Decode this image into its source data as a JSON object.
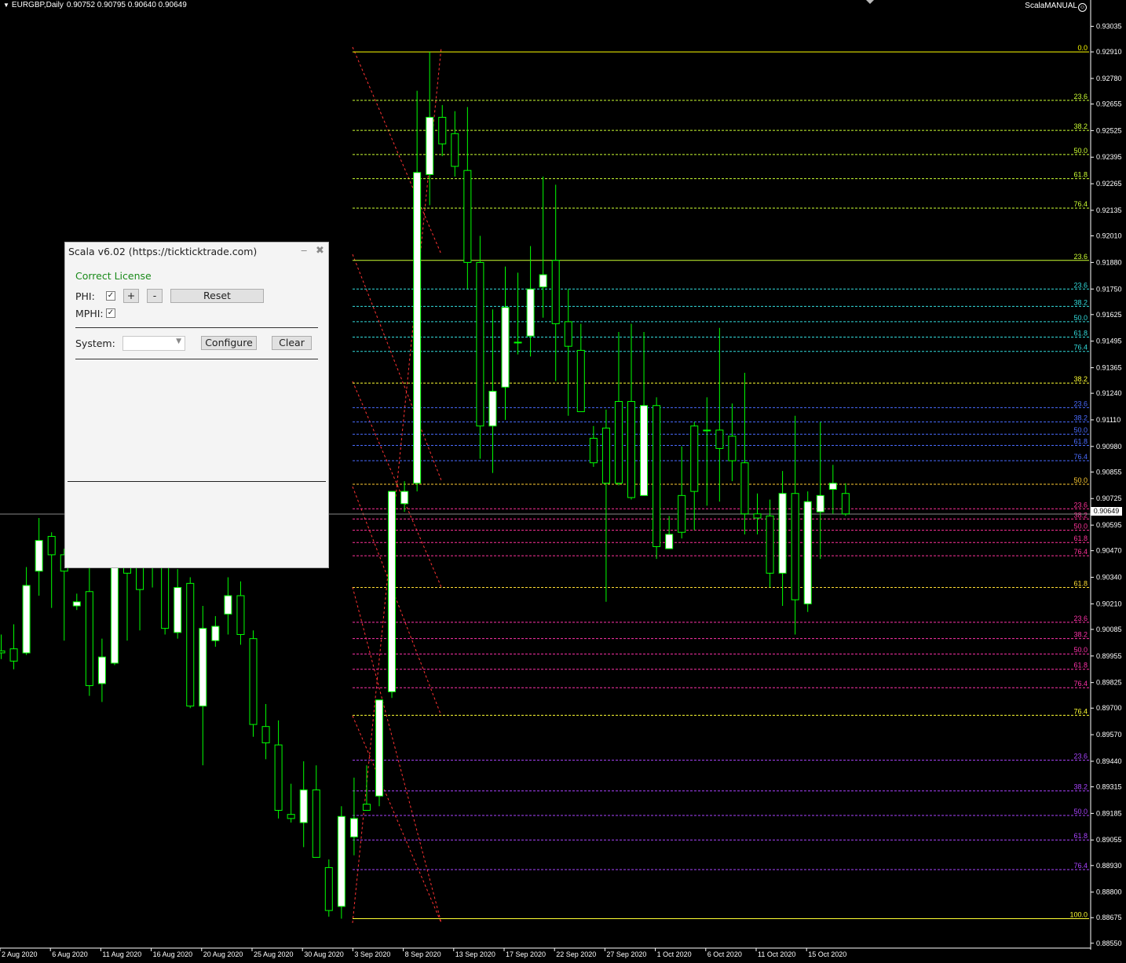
{
  "chart_header": {
    "symbol": "EURGBP,Daily",
    "ohlc": "0.90752 0.90795 0.90640 0.90649",
    "brand": "ScalaMANUAL"
  },
  "current_price": "0.90649",
  "colors": {
    "background": "#000000",
    "bull_fill": "#ffffff",
    "bear_fill": "#000000",
    "candle_border": "#00ff00",
    "axis_text": "#ffffff"
  },
  "chart_data": {
    "type": "candlestick",
    "price_axis": {
      "min": 0.8853,
      "max": 0.9311,
      "ticks": [
        "0.93035",
        "0.92910",
        "0.92780",
        "0.92655",
        "0.92525",
        "0.92395",
        "0.92265",
        "0.92135",
        "0.92010",
        "0.91880",
        "0.91750",
        "0.91625",
        "0.91495",
        "0.91365",
        "0.91240",
        "0.91110",
        "0.90980",
        "0.90855",
        "0.90725",
        "0.90595",
        "0.90470",
        "0.90340",
        "0.90210",
        "0.90085",
        "0.89955",
        "0.89825",
        "0.89700",
        "0.89570",
        "0.89440",
        "0.89315",
        "0.89185",
        "0.89055",
        "0.88930",
        "0.88800",
        "0.88675",
        "0.88550"
      ]
    },
    "date_labels": [
      "2 Aug 2020",
      "6 Aug 2020",
      "11 Aug 2020",
      "16 Aug 2020",
      "20 Aug 2020",
      "25 Aug 2020",
      "30 Aug 2020",
      "3 Sep 2020",
      "8 Sep 2020",
      "13 Sep 2020",
      "17 Sep 2020",
      "22 Sep 2020",
      "27 Sep 2020",
      "1 Oct 2020",
      "6 Oct 2020",
      "11 Oct 2020",
      "15 Oct 2020"
    ],
    "candles": [
      {
        "o": 0.8998,
        "h": 0.9006,
        "l": 0.8994,
        "c": 0.8997
      },
      {
        "o": 0.8999,
        "h": 0.9011,
        "l": 0.8989,
        "c": 0.8993
      },
      {
        "o": 0.8997,
        "h": 0.9039,
        "l": 0.8996,
        "c": 0.903
      },
      {
        "o": 0.9037,
        "h": 0.9063,
        "l": 0.9025,
        "c": 0.9052
      },
      {
        "o": 0.9054,
        "h": 0.9056,
        "l": 0.9019,
        "c": 0.9045
      },
      {
        "o": 0.9045,
        "h": 0.9048,
        "l": 0.9003,
        "c": 0.9037
      },
      {
        "o": 0.902,
        "h": 0.9026,
        "l": 0.9018,
        "c": 0.9022
      },
      {
        "o": 0.9027,
        "h": 0.9049,
        "l": 0.8976,
        "c": 0.8981
      },
      {
        "o": 0.8982,
        "h": 0.9004,
        "l": 0.8973,
        "c": 0.8995
      },
      {
        "o": 0.8992,
        "h": 0.9052,
        "l": 0.8991,
        "c": 0.9043
      },
      {
        "o": 0.9044,
        "h": 0.9048,
        "l": 0.9003,
        "c": 0.9036
      },
      {
        "o": 0.905,
        "h": 0.9056,
        "l": 0.9008,
        "c": 0.9028
      },
      {
        "o": 0.904,
        "h": 0.9047,
        "l": 0.9029,
        "c": 0.9045
      },
      {
        "o": 0.9041,
        "h": 0.9045,
        "l": 0.9006,
        "c": 0.9009
      },
      {
        "o": 0.9007,
        "h": 0.9038,
        "l": 0.9004,
        "c": 0.9029
      },
      {
        "o": 0.9031,
        "h": 0.9034,
        "l": 0.897,
        "c": 0.8971
      },
      {
        "o": 0.8971,
        "h": 0.902,
        "l": 0.8942,
        "c": 0.9009
      },
      {
        "o": 0.9003,
        "h": 0.9015,
        "l": 0.9,
        "c": 0.901
      },
      {
        "o": 0.9016,
        "h": 0.9034,
        "l": 0.9006,
        "c": 0.9025
      },
      {
        "o": 0.9025,
        "h": 0.9032,
        "l": 0.9001,
        "c": 0.9006
      },
      {
        "o": 0.9004,
        "h": 0.9008,
        "l": 0.8956,
        "c": 0.8962
      },
      {
        "o": 0.8961,
        "h": 0.8972,
        "l": 0.8945,
        "c": 0.8953
      },
      {
        "o": 0.8952,
        "h": 0.8964,
        "l": 0.8916,
        "c": 0.892
      },
      {
        "o": 0.8918,
        "h": 0.8933,
        "l": 0.8914,
        "c": 0.8916
      },
      {
        "o": 0.8914,
        "h": 0.8944,
        "l": 0.8902,
        "c": 0.893
      },
      {
        "o": 0.893,
        "h": 0.8942,
        "l": 0.8899,
        "c": 0.8897
      },
      {
        "o": 0.8892,
        "h": 0.8896,
        "l": 0.8868,
        "c": 0.8871
      },
      {
        "o": 0.8873,
        "h": 0.8922,
        "l": 0.8867,
        "c": 0.8917
      },
      {
        "o": 0.8907,
        "h": 0.8936,
        "l": 0.8898,
        "c": 0.8916
      },
      {
        "o": 0.8923,
        "h": 0.8942,
        "l": 0.892,
        "c": 0.892
      },
      {
        "o": 0.8927,
        "h": 0.8966,
        "l": 0.8922,
        "c": 0.8974
      },
      {
        "o": 0.8978,
        "h": 0.9072,
        "l": 0.8975,
        "c": 0.9076
      },
      {
        "o": 0.907,
        "h": 0.9081,
        "l": 0.9066,
        "c": 0.9076
      },
      {
        "o": 0.908,
        "h": 0.9272,
        "l": 0.9076,
        "c": 0.9232
      },
      {
        "o": 0.9231,
        "h": 0.9291,
        "l": 0.9216,
        "c": 0.9259
      },
      {
        "o": 0.9259,
        "h": 0.9265,
        "l": 0.924,
        "c": 0.9246
      },
      {
        "o": 0.9251,
        "h": 0.9262,
        "l": 0.923,
        "c": 0.9235
      },
      {
        "o": 0.9233,
        "h": 0.9264,
        "l": 0.9175,
        "c": 0.9188
      },
      {
        "o": 0.9188,
        "h": 0.9201,
        "l": 0.9092,
        "c": 0.9108
      },
      {
        "o": 0.9108,
        "h": 0.9165,
        "l": 0.9085,
        "c": 0.9125
      },
      {
        "o": 0.9127,
        "h": 0.9186,
        "l": 0.9111,
        "c": 0.9166
      },
      {
        "o": 0.9149,
        "h": 0.9183,
        "l": 0.9143,
        "c": 0.9149
      },
      {
        "o": 0.9152,
        "h": 0.9196,
        "l": 0.9142,
        "c": 0.9175
      },
      {
        "o": 0.9176,
        "h": 0.923,
        "l": 0.9161,
        "c": 0.9182
      },
      {
        "o": 0.9189,
        "h": 0.9226,
        "l": 0.913,
        "c": 0.9158
      },
      {
        "o": 0.9159,
        "h": 0.9175,
        "l": 0.9113,
        "c": 0.9147
      },
      {
        "o": 0.9145,
        "h": 0.9158,
        "l": 0.9118,
        "c": 0.9115
      },
      {
        "o": 0.9102,
        "h": 0.9108,
        "l": 0.9088,
        "c": 0.909
      },
      {
        "o": 0.9107,
        "h": 0.9116,
        "l": 0.9022,
        "c": 0.908
      },
      {
        "o": 0.912,
        "h": 0.9154,
        "l": 0.9079,
        "c": 0.908
      },
      {
        "o": 0.912,
        "h": 0.9158,
        "l": 0.9072,
        "c": 0.9073
      },
      {
        "o": 0.9074,
        "h": 0.9154,
        "l": 0.9074,
        "c": 0.9118
      },
      {
        "o": 0.9118,
        "h": 0.9122,
        "l": 0.9043,
        "c": 0.9049
      },
      {
        "o": 0.9048,
        "h": 0.9064,
        "l": 0.9048,
        "c": 0.9055
      },
      {
        "o": 0.9074,
        "h": 0.9098,
        "l": 0.9053,
        "c": 0.9056
      },
      {
        "o": 0.9108,
        "h": 0.911,
        "l": 0.9057,
        "c": 0.9076
      },
      {
        "o": 0.9106,
        "h": 0.9122,
        "l": 0.9069,
        "c": 0.9106
      },
      {
        "o": 0.9106,
        "h": 0.9156,
        "l": 0.9071,
        "c": 0.9097
      },
      {
        "o": 0.9103,
        "h": 0.9119,
        "l": 0.9081,
        "c": 0.9091
      },
      {
        "o": 0.909,
        "h": 0.9134,
        "l": 0.9055,
        "c": 0.9065
      },
      {
        "o": 0.9065,
        "h": 0.9075,
        "l": 0.9055,
        "c": 0.9063
      },
      {
        "o": 0.9064,
        "h": 0.9072,
        "l": 0.9029,
        "c": 0.9036
      },
      {
        "o": 0.9036,
        "h": 0.9086,
        "l": 0.902,
        "c": 0.9075
      },
      {
        "o": 0.9075,
        "h": 0.9113,
        "l": 0.9006,
        "c": 0.9023
      },
      {
        "o": 0.9021,
        "h": 0.9076,
        "l": 0.9017,
        "c": 0.9071
      },
      {
        "o": 0.9066,
        "h": 0.911,
        "l": 0.9043,
        "c": 0.9074
      },
      {
        "o": 0.9077,
        "h": 0.9089,
        "l": 0.9065,
        "c": 0.908
      },
      {
        "o": 0.9075,
        "h": 0.908,
        "l": 0.9064,
        "c": 0.9065
      }
    ],
    "fib_levels": [
      {
        "price": 0.9291,
        "label": "0.0",
        "color": "#ffff00",
        "dash": false
      },
      {
        "price": 0.92673,
        "label": "23.6",
        "color": "#ccff33",
        "dash": true
      },
      {
        "price": 0.92526,
        "label": "38.2",
        "color": "#ccff33",
        "dash": true
      },
      {
        "price": 0.92408,
        "label": "50.0",
        "color": "#ccff33",
        "dash": true
      },
      {
        "price": 0.9229,
        "label": "61.8",
        "color": "#ccff33",
        "dash": true
      },
      {
        "price": 0.92146,
        "label": "76.4",
        "color": "#ccff33",
        "dash": true
      },
      {
        "price": 0.9189,
        "label": "23.6",
        "color": "#ccff33",
        "dash": false
      },
      {
        "price": 0.9175,
        "label": "23.6",
        "color": "#33dddd",
        "dash": true
      },
      {
        "price": 0.91665,
        "label": "38.2",
        "color": "#33dddd",
        "dash": true
      },
      {
        "price": 0.9159,
        "label": "50.0",
        "color": "#33dddd",
        "dash": true
      },
      {
        "price": 0.91515,
        "label": "61.8",
        "color": "#33dddd",
        "dash": true
      },
      {
        "price": 0.91445,
        "label": "76.4",
        "color": "#33dddd",
        "dash": true
      },
      {
        "price": 0.9129,
        "label": "38.2",
        "color": "#ffff33",
        "dash": true
      },
      {
        "price": 0.9117,
        "label": "23.6",
        "color": "#4a6cff",
        "dash": true
      },
      {
        "price": 0.911,
        "label": "38.2",
        "color": "#4a6cff",
        "dash": true
      },
      {
        "price": 0.9104,
        "label": "50.0",
        "color": "#4a6cff",
        "dash": true
      },
      {
        "price": 0.90985,
        "label": "61.8",
        "color": "#4a6cff",
        "dash": true
      },
      {
        "price": 0.9091,
        "label": "76.4",
        "color": "#4a6cff",
        "dash": true
      },
      {
        "price": 0.90795,
        "label": "50.0",
        "color": "#ffcc33",
        "dash": true
      },
      {
        "price": 0.90675,
        "label": "23.6",
        "color": "#ff3399",
        "dash": true
      },
      {
        "price": 0.90625,
        "label": "38.2",
        "color": "#ff3399",
        "dash": true
      },
      {
        "price": 0.9057,
        "label": "50.0",
        "color": "#ff3399",
        "dash": true
      },
      {
        "price": 0.9051,
        "label": "61.8",
        "color": "#ff3399",
        "dash": true
      },
      {
        "price": 0.90445,
        "label": "76.4",
        "color": "#ff3399",
        "dash": true
      },
      {
        "price": 0.9029,
        "label": "61.8",
        "color": "#ffdd33",
        "dash": true
      },
      {
        "price": 0.9012,
        "label": "23.6",
        "color": "#ff33aa",
        "dash": true
      },
      {
        "price": 0.9004,
        "label": "38.2",
        "color": "#ff33aa",
        "dash": true
      },
      {
        "price": 0.89965,
        "label": "50.0",
        "color": "#ff33aa",
        "dash": true
      },
      {
        "price": 0.8989,
        "label": "61.8",
        "color": "#ff33aa",
        "dash": true
      },
      {
        "price": 0.898,
        "label": "76.4",
        "color": "#ff33aa",
        "dash": true
      },
      {
        "price": 0.89665,
        "label": "76.4",
        "color": "#ffff33",
        "dash": true
      },
      {
        "price": 0.89445,
        "label": "23.6",
        "color": "#aa44ff",
        "dash": true
      },
      {
        "price": 0.89295,
        "label": "38.2",
        "color": "#aa44ff",
        "dash": true
      },
      {
        "price": 0.89175,
        "label": "50.0",
        "color": "#aa44ff",
        "dash": true
      },
      {
        "price": 0.89055,
        "label": "61.8",
        "color": "#aa44ff",
        "dash": true
      },
      {
        "price": 0.8891,
        "label": "76.4",
        "color": "#aa44ff",
        "dash": true
      },
      {
        "price": 0.8867,
        "label": "100.0",
        "color": "#ffff33",
        "dash": false
      }
    ]
  },
  "panel": {
    "title": "Scala v6.02 (https://tickticktrade.com)",
    "license": "Correct License",
    "phi_label": "PHI:",
    "mphi_label": "MPHI:",
    "check_glyph": "✓",
    "plus_label": "+",
    "minus_label": "-",
    "reset_label": "Reset",
    "system_label": "System:",
    "system_value": "",
    "configure_label": "Configure",
    "clear_label": "Clear"
  }
}
